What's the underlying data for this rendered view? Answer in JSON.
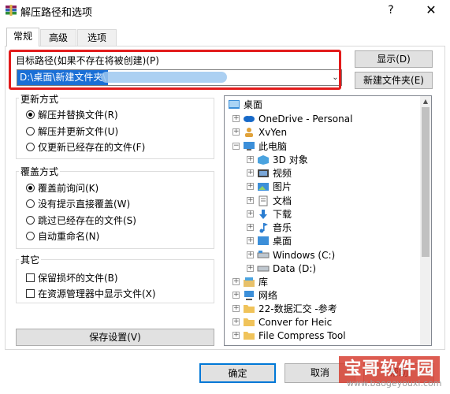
{
  "window": {
    "title": "解压路径和选项",
    "help_glyph": "?",
    "close_glyph": "✕"
  },
  "tabs": [
    {
      "label": "常规",
      "active": true
    },
    {
      "label": "高级",
      "active": false
    },
    {
      "label": "选项",
      "active": false
    }
  ],
  "path": {
    "label": "目标路径(如果不存在将被创建)(P)",
    "value": "D:\\桌面\\新建文件夹\\",
    "redacted": true
  },
  "buttons": {
    "show": "显示(D)",
    "new_folder": "新建文件夹(E)",
    "save_settings": "保存设置(V)",
    "ok": "确定",
    "cancel": "取消",
    "help": "帮助"
  },
  "update_mode": {
    "title": "更新方式",
    "options": [
      {
        "label": "解压并替换文件(R)",
        "checked": true
      },
      {
        "label": "解压并更新文件(U)",
        "checked": false
      },
      {
        "label": "仅更新已经存在的文件(F)",
        "checked": false
      }
    ]
  },
  "overwrite_mode": {
    "title": "覆盖方式",
    "options": [
      {
        "label": "覆盖前询问(K)",
        "checked": true
      },
      {
        "label": "没有提示直接覆盖(W)",
        "checked": false
      },
      {
        "label": "跳过已经存在的文件(S)",
        "checked": false
      },
      {
        "label": "自动重命名(N)",
        "checked": false
      }
    ]
  },
  "misc": {
    "title": "其它",
    "options": [
      {
        "label": "保留损坏的文件(B)",
        "checked": false
      },
      {
        "label": "在资源管理器中显示文件(X)",
        "checked": false
      }
    ]
  },
  "tree": [
    {
      "label": "桌面",
      "icon": "desktop-folder-icon",
      "level": 0,
      "expander": false
    },
    {
      "label": "OneDrive - Personal",
      "icon": "onedrive-cloud-icon",
      "level": 1,
      "expander": true
    },
    {
      "label": "XvYen",
      "icon": "user-folder-icon",
      "level": 1,
      "expander": true
    },
    {
      "label": "此电脑",
      "icon": "computer-icon",
      "level": 1,
      "expander": "open"
    },
    {
      "label": "3D 对象",
      "icon": "3d-objects-icon",
      "level": 2,
      "expander": true
    },
    {
      "label": "视频",
      "icon": "video-icon",
      "level": 2,
      "expander": true
    },
    {
      "label": "图片",
      "icon": "pictures-icon",
      "level": 2,
      "expander": true
    },
    {
      "label": "文档",
      "icon": "documents-icon",
      "level": 2,
      "expander": true
    },
    {
      "label": "下载",
      "icon": "download-icon",
      "level": 2,
      "expander": true
    },
    {
      "label": "音乐",
      "icon": "music-icon",
      "level": 2,
      "expander": true
    },
    {
      "label": "桌面",
      "icon": "desktop-icon",
      "level": 2,
      "expander": true
    },
    {
      "label": "Windows (C:)",
      "icon": "drive-icon",
      "level": 2,
      "expander": true
    },
    {
      "label": "Data (D:)",
      "icon": "drive-icon",
      "level": 2,
      "expander": true
    },
    {
      "label": "库",
      "icon": "library-icon",
      "level": 1,
      "expander": true
    },
    {
      "label": "网络",
      "icon": "network-icon",
      "level": 1,
      "expander": true
    },
    {
      "label": "22-数据汇交 -参考",
      "icon": "folder-icon",
      "level": 1,
      "expander": true
    },
    {
      "label": "Conver for Heic",
      "icon": "folder-icon",
      "level": 1,
      "expander": true
    },
    {
      "label": "File Compress Tool",
      "icon": "folder-icon",
      "level": 1,
      "expander": true
    }
  ],
  "watermark": {
    "text": "宝哥软件园",
    "url": "www.baogeyouxi.com"
  },
  "colors": {
    "highlight": "#e21b1b",
    "selection": "#1a6fd6",
    "default_button_border": "#0078d7"
  }
}
